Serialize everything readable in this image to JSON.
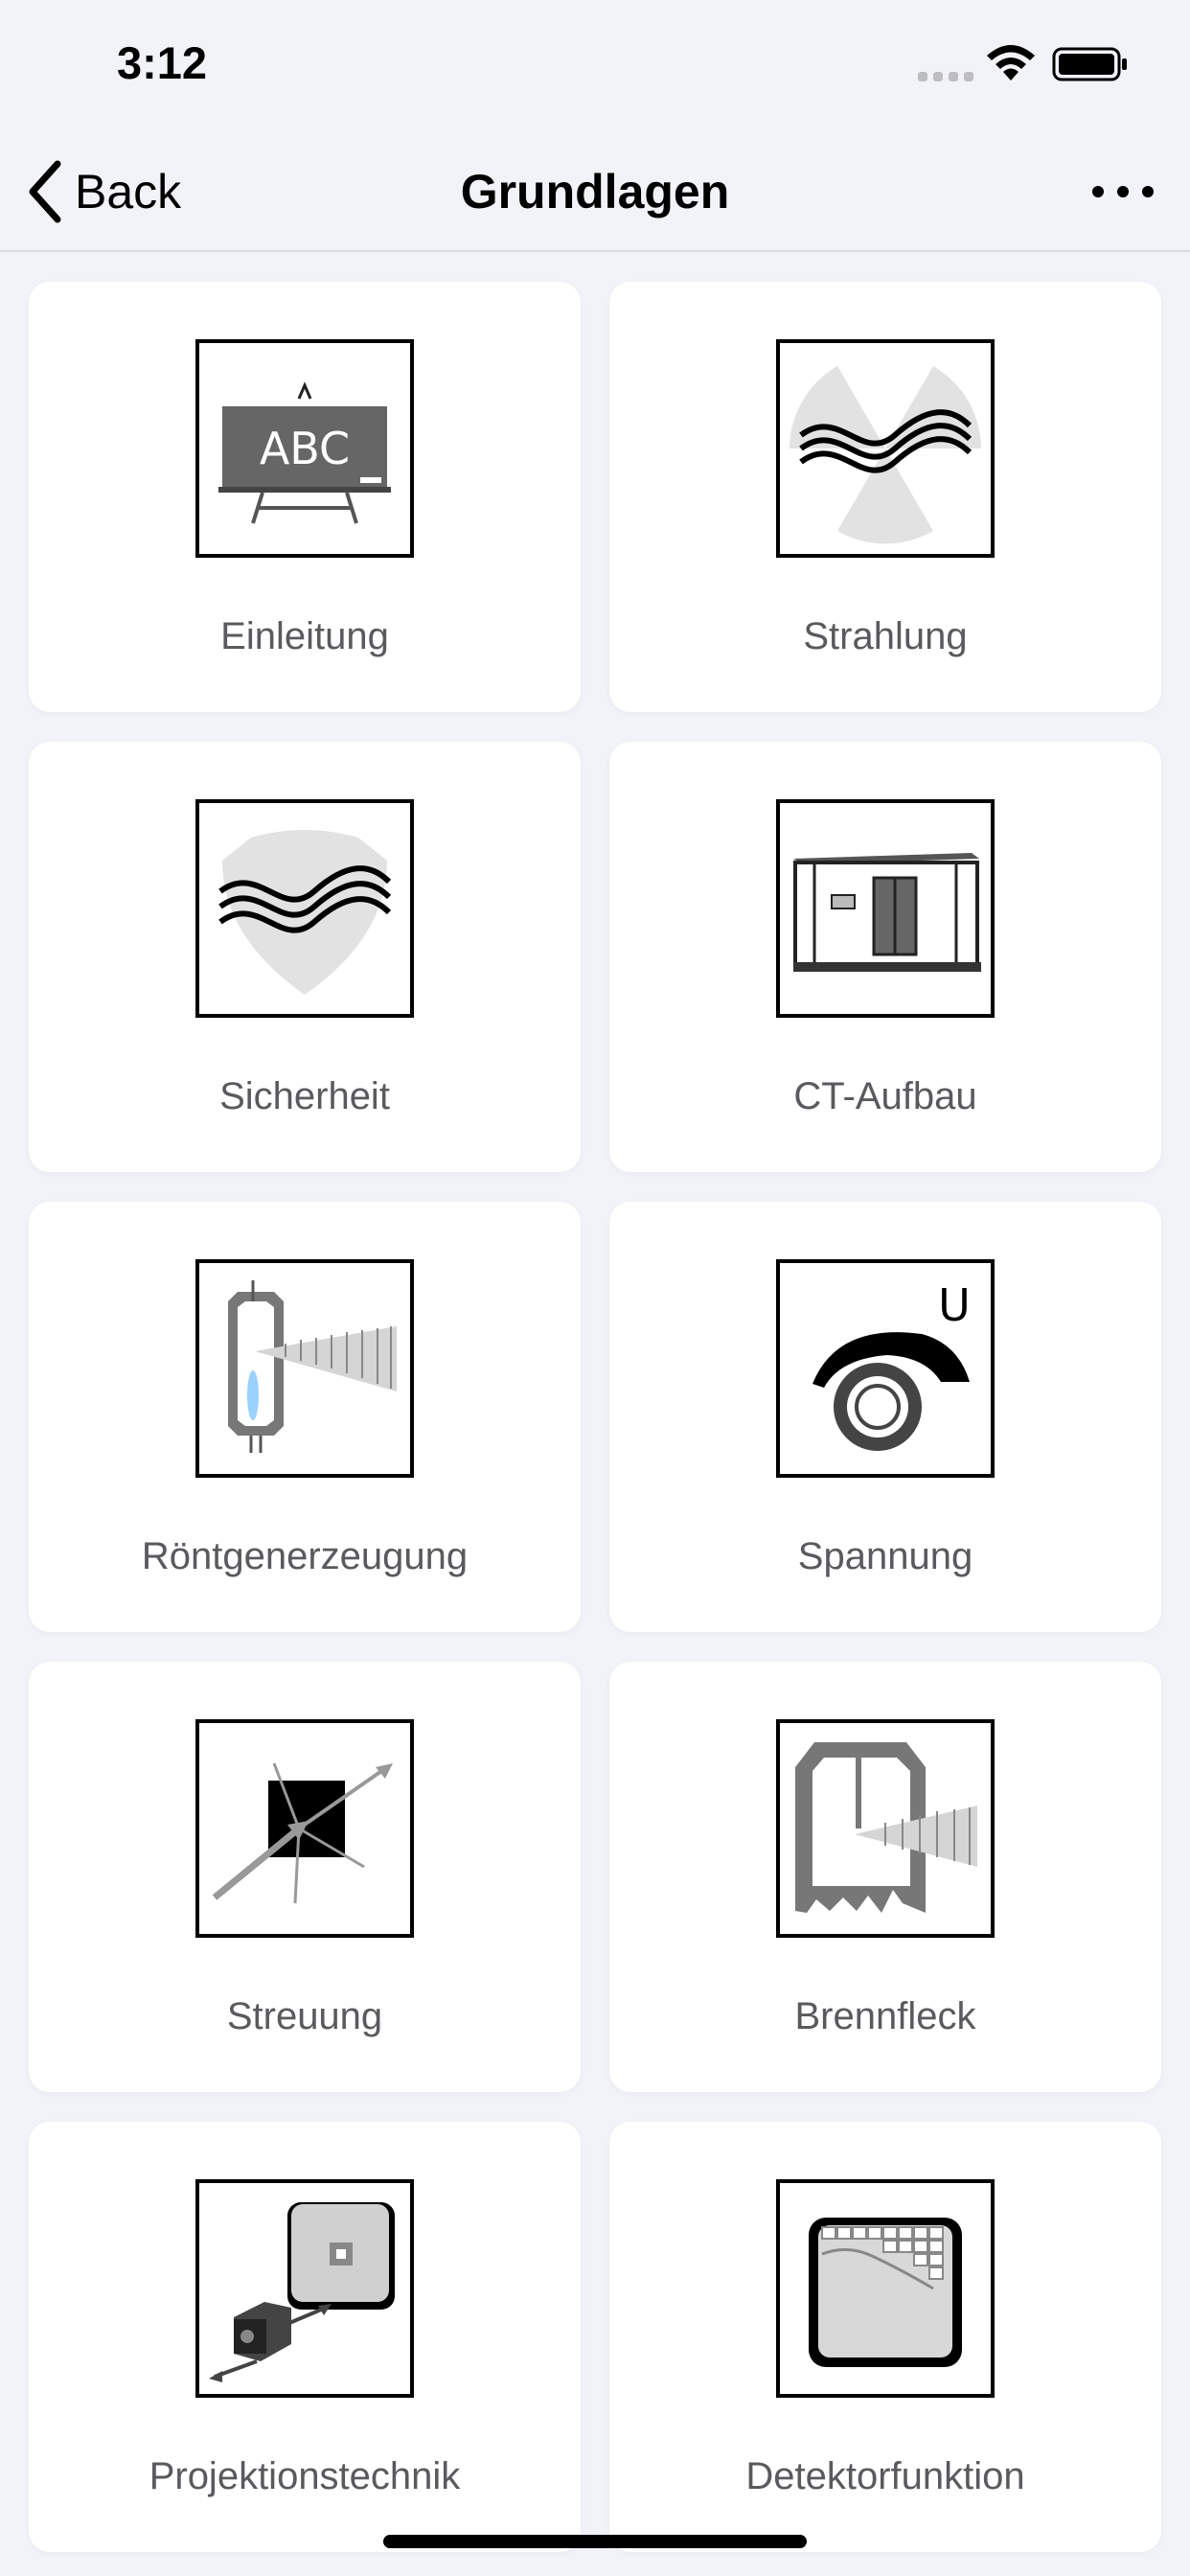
{
  "status_bar": {
    "time": "3:12"
  },
  "nav": {
    "back_label": "Back",
    "title": "Grundlagen"
  },
  "tiles": [
    {
      "label": "Einleitung",
      "icon": "chalkboard-icon"
    },
    {
      "label": "Strahlung",
      "icon": "radiation-icon"
    },
    {
      "label": "Sicherheit",
      "icon": "shield-icon"
    },
    {
      "label": "CT-Aufbau",
      "icon": "ct-cabinet-icon"
    },
    {
      "label": "Röntgenerzeugung",
      "icon": "xray-tube-icon"
    },
    {
      "label": "Spannung",
      "icon": "voltage-dial-icon"
    },
    {
      "label": "Streuung",
      "icon": "scattering-icon"
    },
    {
      "label": "Brennfleck",
      "icon": "focal-spot-icon"
    },
    {
      "label": "Projektionstechnik",
      "icon": "projection-icon"
    },
    {
      "label": "Detektorfunktion",
      "icon": "detector-icon"
    }
  ],
  "icon_text": {
    "chalkboard": "ABC",
    "voltage_symbol": "U"
  }
}
